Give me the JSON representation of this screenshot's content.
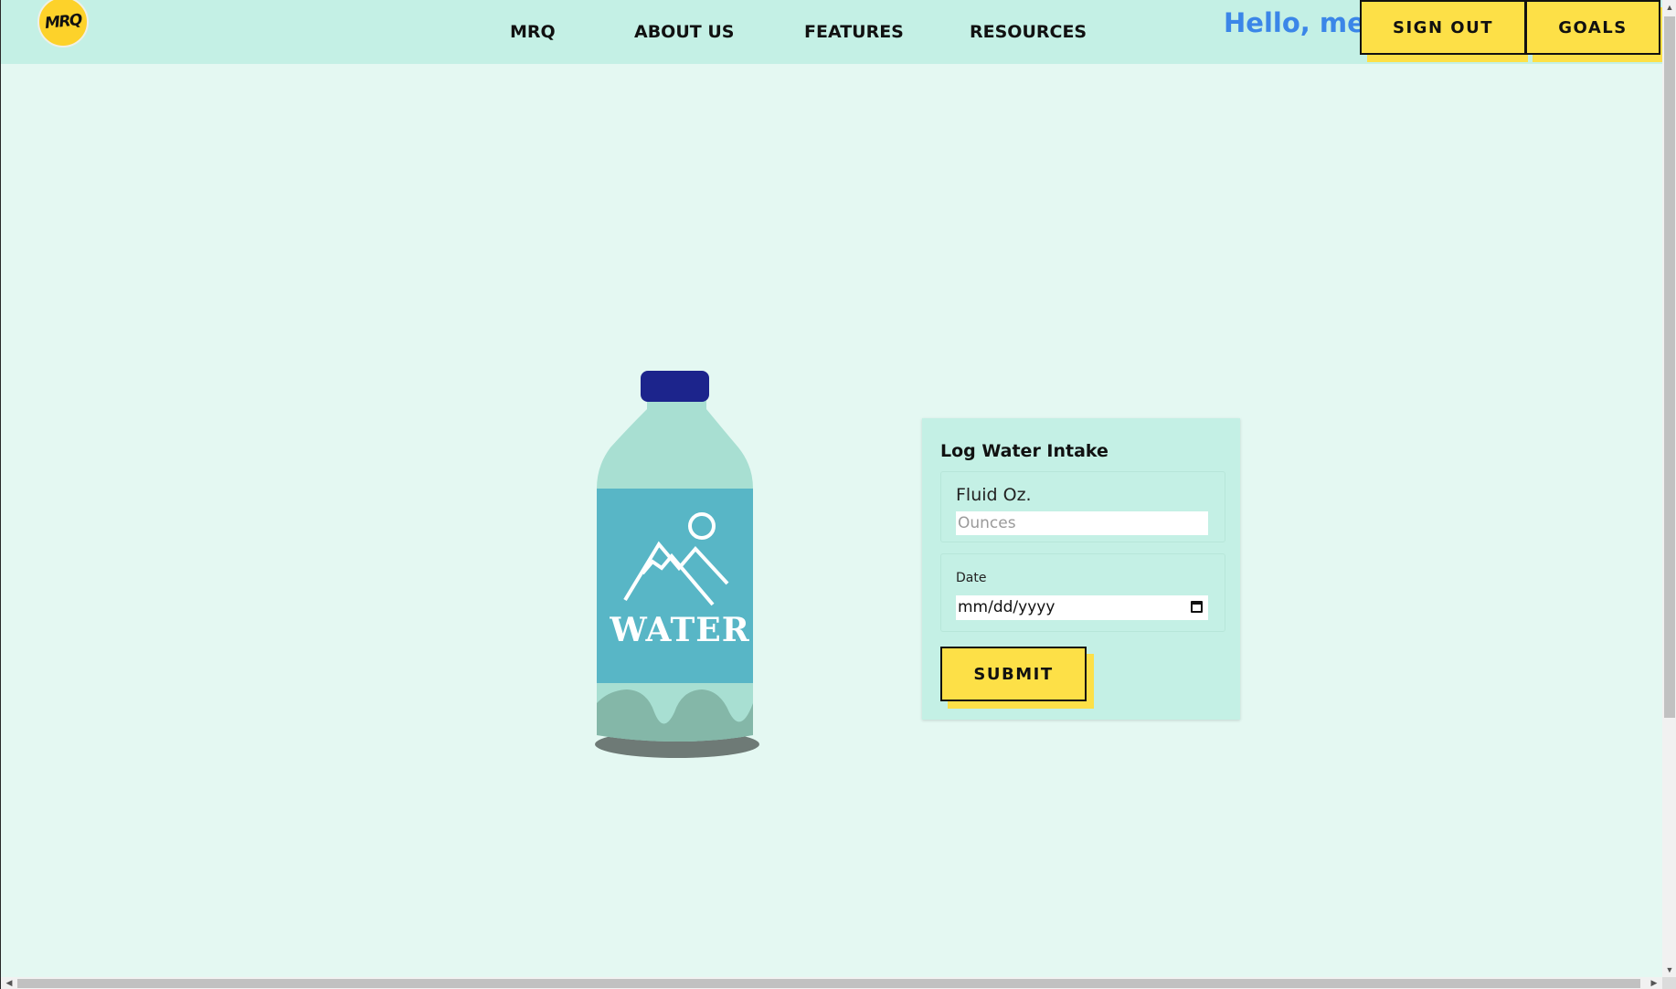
{
  "header": {
    "logo_text": "MRQ",
    "nav": [
      {
        "label": "MRQ"
      },
      {
        "label": "ABOUT US"
      },
      {
        "label": "FEATURES"
      },
      {
        "label": "RESOURCES"
      }
    ],
    "greeting": "Hello, me",
    "sign_out_label": "SIGN OUT",
    "goals_label": "GOALS"
  },
  "illustration": {
    "bottle_label": "WATER"
  },
  "form": {
    "title": "Log Water Intake",
    "ounces_label": "Fluid Oz.",
    "ounces_placeholder": "Ounces",
    "ounces_value": "",
    "date_label": "Date",
    "date_value": "mm/dd/yyyy",
    "submit_label": "SUBMIT"
  },
  "colors": {
    "page_bg": "#e4f8f2",
    "header_bg": "#c4f0e5",
    "accent_yellow": "#fde047",
    "greeting_blue": "#3b86e8",
    "bottle_cap": "#1c248c",
    "bottle_body": "#a8dfd2",
    "bottle_label": "#58b6c6"
  }
}
